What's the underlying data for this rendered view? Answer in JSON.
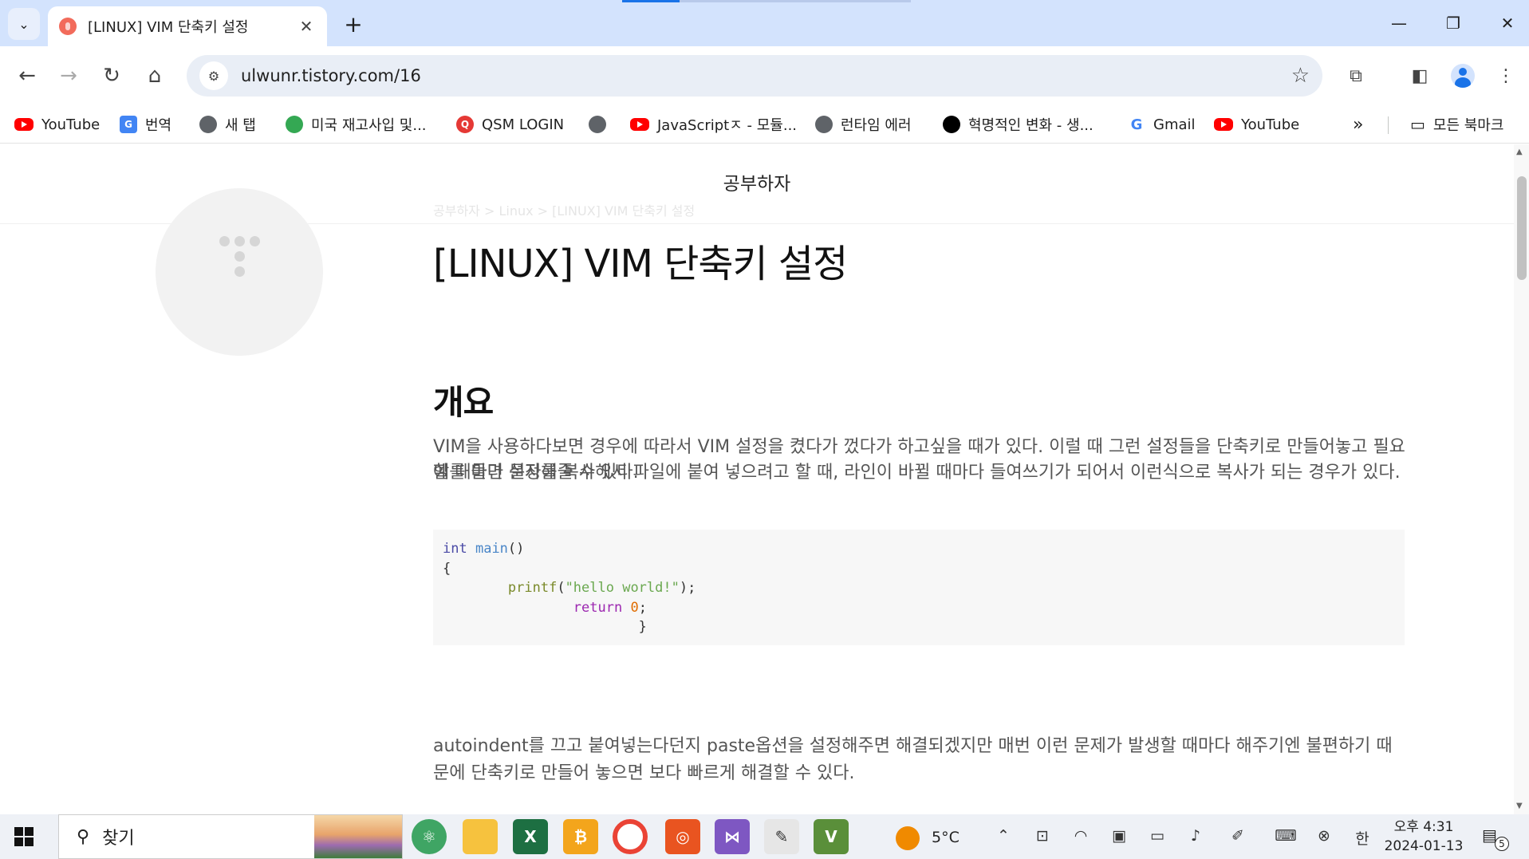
{
  "browser": {
    "tab": {
      "title": "[LINUX] VIM 단축키 설정",
      "close": "✕"
    },
    "new_tab": "+",
    "window": {
      "minimize": "—",
      "restore": "❐",
      "close": "✕"
    },
    "url": "ulwunr.tistory.com/16",
    "bookmarks": [
      {
        "label": "YouTube",
        "icon": "youtube-icon"
      },
      {
        "label": "번역",
        "icon": "translate-icon"
      },
      {
        "label": "새 탭",
        "icon": "globe-icon"
      },
      {
        "label": "미국 재고사입 및...",
        "icon": "cup-icon"
      },
      {
        "label": "QSM LOGIN",
        "icon": "qsm-icon"
      },
      {
        "label": "",
        "icon": "globe-icon"
      },
      {
        "label": "JavaScriptㅈ - 모듈...",
        "icon": "youtube-icon"
      },
      {
        "label": "런타임 에러",
        "icon": "globe-icon"
      },
      {
        "label": "혁명적인 변화 - 생...",
        "icon": "circle-icon"
      },
      {
        "label": "Gmail",
        "icon": "google-icon"
      },
      {
        "label": "YouTube",
        "icon": "youtube-icon"
      }
    ],
    "bookmarks_more": "»",
    "all_bookmarks": "모든 북마크"
  },
  "page": {
    "blog_name": "공부하자",
    "breadcrumb": "공부하자 > Linux > [LINUX] VIM 단축키 설정",
    "post_title": "[LINUX] VIM 단축키 설정",
    "section_heading": "개요",
    "para1": "VIM을 사용하다보면 경우에 따라서 VIM 설정을 켰다가 껐다가 하고싶을 때가 있다. 이럴 때 그런 설정들을 단축키로 만들어놓고 필요할 때마다 설정해줄 수 있다.",
    "para2": "예를 들면 문자를 복사해서 파일에 붙여 넣으려고 할 때, 라인이 바뀔 때마다 들여쓰기가 되어서 이런식으로 복사가 되는 경우가 있다.",
    "code": {
      "l1_type": "int",
      "l1_fn": "main",
      "l1_rest": "()",
      "l2": "{",
      "l3_fn": "printf",
      "l3_open": "(",
      "l3_str": "\"hello world!\"",
      "l3_close": ");",
      "l4_kw": "return",
      "l4_num": "0",
      "l4_end": ";",
      "l5": "}"
    },
    "para3": "autoindent를 끄고 붙여넣는다던지 paste옵션을 설정해주면 해결되겠지만 매번 이런 문제가 발생할 때마다 해주기엔 불편하기 때문에 단축키로 만들어 놓으면 보다 빠르게 해결할 수 있다."
  },
  "taskbar": {
    "search_placeholder": "찾기",
    "weather_temp": "5°C",
    "ime": "한",
    "time": "오후 4:31",
    "date": "2024-01-13",
    "notifications": "5"
  }
}
